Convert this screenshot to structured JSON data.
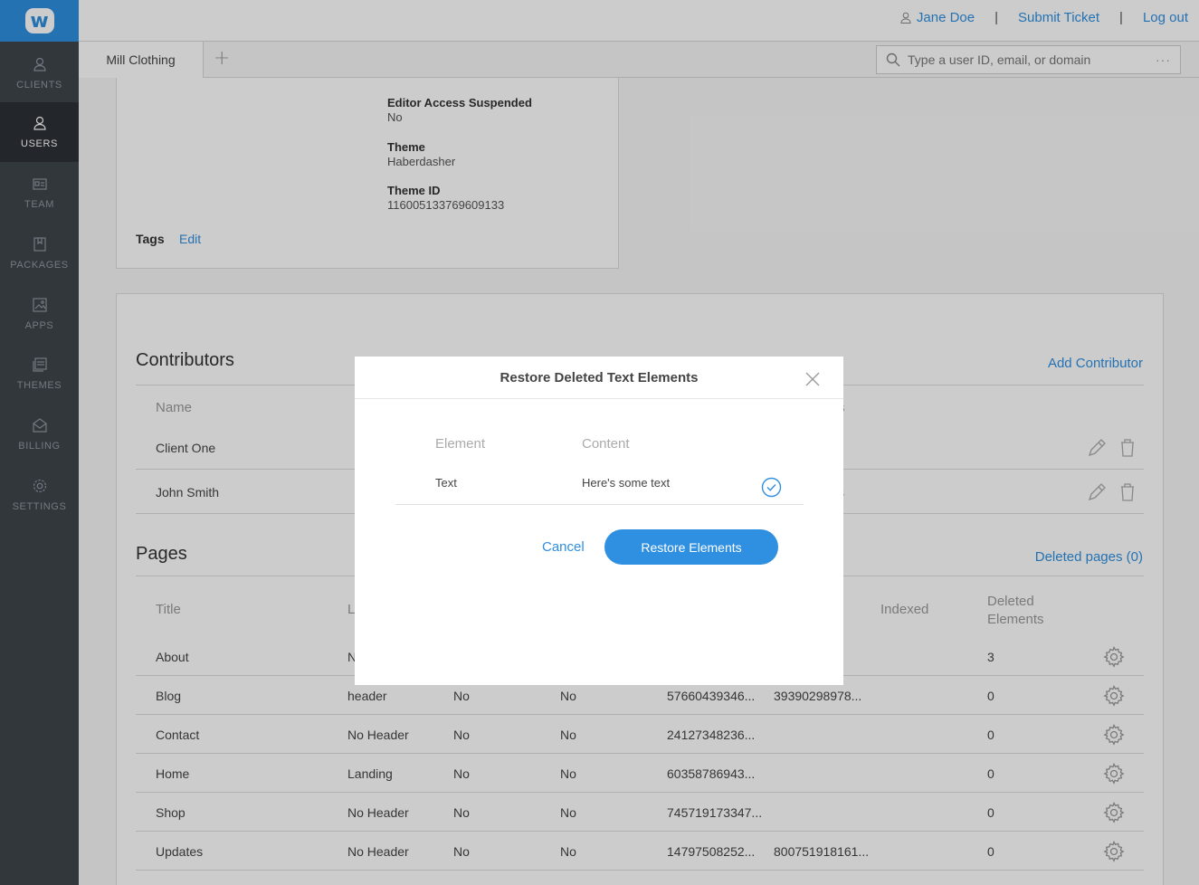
{
  "sidebar": {
    "logo": "w",
    "items": [
      {
        "label": "CLIENTS",
        "icon": "client-icon"
      },
      {
        "label": "USERS",
        "icon": "user-icon"
      },
      {
        "label": "TEAM",
        "icon": "team-icon"
      },
      {
        "label": "PACKAGES",
        "icon": "package-icon"
      },
      {
        "label": "APPS",
        "icon": "apps-icon"
      },
      {
        "label": "THEMES",
        "icon": "themes-icon"
      },
      {
        "label": "BILLING",
        "icon": "billing-icon"
      },
      {
        "label": "SETTINGS",
        "icon": "gear-icon"
      }
    ]
  },
  "topbar": {
    "user_name": "Jane Doe",
    "submit_ticket": "Submit Ticket",
    "logout": "Log out",
    "separator": "|"
  },
  "tabbar": {
    "tab_label": "Mill Clothing",
    "add_label": "+",
    "search_placeholder": "Type a user ID, email, or domain",
    "search_more": "···"
  },
  "site_info": {
    "fields": [
      {
        "key": "Editor Access Suspended",
        "value": "No"
      },
      {
        "key": "Theme",
        "value": "Haberdasher"
      },
      {
        "key": "Theme ID",
        "value": "116005133769609133"
      }
    ],
    "tags_label": "Tags",
    "tags_edit": "Edit"
  },
  "contributors": {
    "title": "Contributors",
    "add_link": "Add Contributor",
    "header_name": "Name",
    "header_partial": "s",
    "rows": [
      {
        "name": "Client One",
        "extra": ""
      },
      {
        "name": "John Smith",
        "extra": "ss"
      }
    ]
  },
  "pages": {
    "title": "Pages",
    "deleted_link": "Deleted pages (0)",
    "headers": {
      "title": "Title",
      "layout_partial": "L",
      "indexed": "Indexed",
      "deleted": "Deleted Elements"
    },
    "rows": [
      {
        "title": "About",
        "layout": "N",
        "c3": "",
        "c4": "",
        "c5": "",
        "c6": "",
        "deleted": "3"
      },
      {
        "title": "Blog",
        "layout": "header",
        "c3": "No",
        "c4": "No",
        "c5": "57660439346...",
        "c6": "39390298978...",
        "deleted": "0"
      },
      {
        "title": "Contact",
        "layout": "No Header",
        "c3": "No",
        "c4": "No",
        "c5": "24127348236...",
        "c6": "",
        "deleted": "0"
      },
      {
        "title": "Home",
        "layout": "Landing",
        "c3": "No",
        "c4": "No",
        "c5": "60358786943...",
        "c6": "",
        "deleted": "0"
      },
      {
        "title": "Shop",
        "layout": "No Header",
        "c3": "No",
        "c4": "No",
        "c5": "745719173347...",
        "c6": "",
        "deleted": "0"
      },
      {
        "title": "Updates",
        "layout": "No Header",
        "c3": "No",
        "c4": "No",
        "c5": "14797508252...",
        "c6": "800751918161...",
        "deleted": "0"
      }
    ]
  },
  "modal": {
    "title": "Restore Deleted Text Elements",
    "col_element": "Element",
    "col_content": "Content",
    "row_element": "Text",
    "row_content": "Here's some text",
    "cancel": "Cancel",
    "restore": "Restore Elements"
  },
  "colors": {
    "accent": "#2f8fe0",
    "sidebar": "#3f454c",
    "sidebar_active": "#2c3137"
  }
}
